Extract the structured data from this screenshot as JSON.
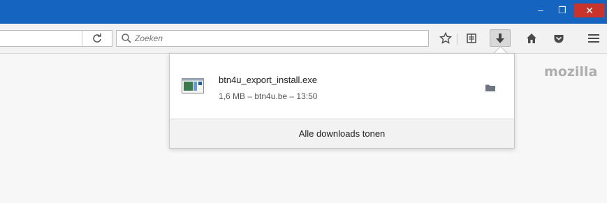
{
  "window": {
    "controls": {
      "minimize": "–",
      "restore": "❐",
      "close": "✕"
    }
  },
  "toolbar": {
    "reload_icon": "reload-icon",
    "search": {
      "placeholder": "Zoeken"
    },
    "icons": [
      "star-icon",
      "reading-list-icon",
      "download-icon",
      "home-icon",
      "pocket-icon",
      "menu-icon"
    ]
  },
  "branding": {
    "text": "mozilla"
  },
  "downloads_panel": {
    "items": [
      {
        "filename": "btn4u_export_install.exe",
        "meta": "1,6 MB – btn4u.be – 13:50"
      }
    ],
    "footer_label": "Alle downloads tonen"
  },
  "colors": {
    "titlebar": "#1565c0",
    "close": "#c8342b",
    "background": "#f7f7f7"
  }
}
